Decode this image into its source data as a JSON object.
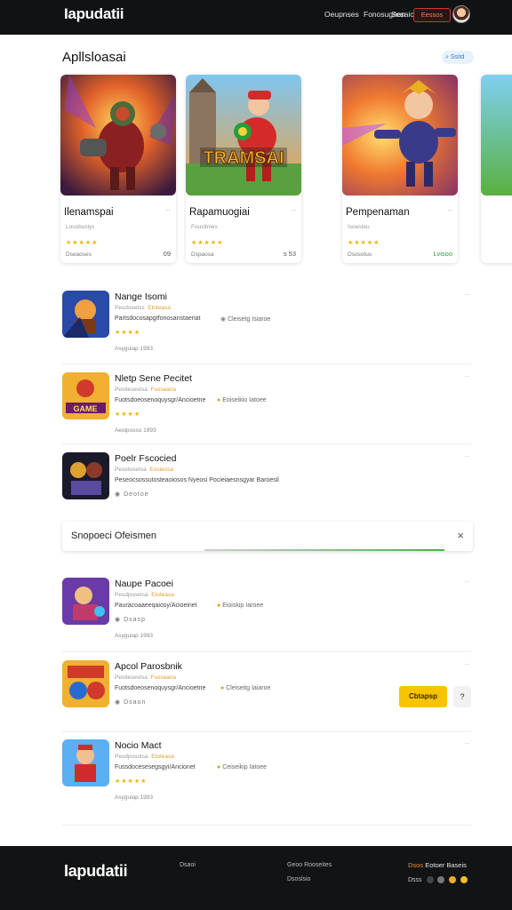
{
  "header": {
    "logo": "Iapudatii",
    "nav": [
      "Oeupnses",
      "Fonosugnon",
      "Sesaic"
    ],
    "action_label": "Eessos",
    "avatar": "user-avatar"
  },
  "featured": {
    "title": "Apllsloasai",
    "search_label": "Ssitd",
    "cards": [
      {
        "art_text": "",
        "title": "Ilenamspai",
        "dots": "··",
        "subtitle": "Lousbusiys",
        "stars": "★★★★★",
        "meta": "Dseaoses",
        "price": "09"
      },
      {
        "art_text": "TRAMSAI",
        "title": "Rapamuogiai",
        "dots": "··",
        "subtitle": "Fousltnies",
        "stars": "★★★★★",
        "meta": "Dspaosa",
        "price": "s 53"
      },
      {
        "art_text": "",
        "title": "Pempenaman",
        "dots": "··",
        "subtitle": "Isoesteu",
        "stars": "★★★★★",
        "meta": "Dsosotus",
        "price": "Lvisoo"
      }
    ]
  },
  "list_top": [
    {
      "title": "Nange Isomi",
      "sub1": "Pesdosetss",
      "sub2": "Etoteasa",
      "desc": "Partsdocosapgtfonosanstaeriat",
      "tag": "Cleisetg Isiaroe",
      "stars": "★★★★",
      "date": "Asyguiap  1993",
      "dots": "··"
    },
    {
      "title": "Nletp Sene Pecitet",
      "sub1": "Pesitesestsa",
      "sub2": "Fsoseana",
      "desc": "Fuotsdoeosenoquysgr/Ancioetne",
      "tag": "Eoiseikio Iatoee",
      "stars": "★★★★",
      "date": "Aestposso  1993",
      "dots": "··"
    },
    {
      "title": "Poelr Fscocied",
      "sub1": "Pesetosetsa",
      "sub2": "Eosieosa",
      "desc": "Peseocsossutosteaoiosos Nyeosi Pocieiaesnsgyar Baroesil",
      "tag": "",
      "stars": "Deotoe",
      "date": "",
      "dots": "··"
    }
  ],
  "banner": {
    "text": "Snopoeci Ofeismen",
    "close": "×"
  },
  "list_bottom": [
    {
      "title": "Naupe Pacoei",
      "sub1": "Pesdposetsa",
      "sub2": "Etoteasa",
      "desc": "Pauracoaaeeqaiosy/Acioeinet",
      "tag": "Eioiskip Iaroee",
      "stars": "Dsasp",
      "date": "Asyguiap  1993",
      "dots": "··"
    },
    {
      "title": "Apcol Parosbnik",
      "sub1": "Pesitesestsa",
      "sub2": "Fsoseana",
      "desc": "Fuotsdoeosenoquysgr/Ancioetne",
      "tag": "Cleiseitg Iaiaroe",
      "stars": "Dsaon",
      "date": "",
      "dots": "··"
    },
    {
      "title": "Nocio Mact",
      "sub1": "Pesdposotsa",
      "sub2": "Etoteasa",
      "desc": "Fussdocesesegsgyi/Ancionet",
      "tag": "Ceiseikip Iatoee",
      "stars": "★★★★★",
      "date": "Asyguiap  1993",
      "dots": "··"
    }
  ],
  "cta": {
    "primary_label": "Cbtapsp",
    "more_label": "?"
  },
  "footer": {
    "logo": "Iapudatii",
    "col1": "Dsaoi",
    "col2_a": "Geoo Rooseites",
    "col2_b": "Dsoslsio",
    "accent_a": "Dsos",
    "accent_b": "Eotoer Baseis",
    "icons_label": "Dsss"
  },
  "colors": {
    "topbar": "#111214",
    "accent_red": "#c43b2b",
    "star": "#f2b301",
    "cta": "#f7c400",
    "footer_accent": "#f08a24"
  }
}
